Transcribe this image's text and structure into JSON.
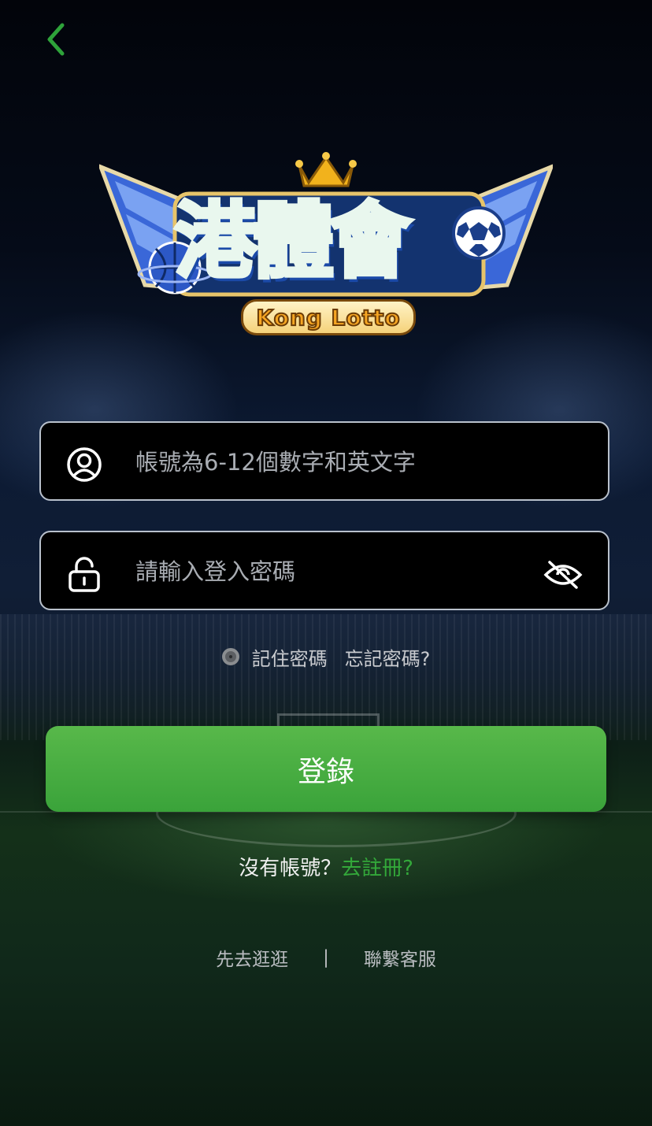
{
  "header": {
    "back_icon": "chevron-left-icon",
    "accent": "#2ea33a"
  },
  "logo": {
    "title": "港體會",
    "subtitle": "Kong Lotto",
    "icons": [
      "crown-icon",
      "wings-icon",
      "basketball-icon",
      "soccer-ball-icon"
    ]
  },
  "form": {
    "account": {
      "icon": "user-icon",
      "placeholder": "帳號為6-12個數字和英文字",
      "value": ""
    },
    "password": {
      "icon": "lock-icon",
      "placeholder": "請輸入登入密碼",
      "value": "",
      "toggle_icon": "eye-off-icon"
    },
    "remember_label": "記住密碼",
    "forgot_label": "忘記密碼?",
    "login_label": "登錄"
  },
  "register": {
    "prompt": "沒有帳號？",
    "link": "去註冊?"
  },
  "footer": {
    "browse": "先去逛逛",
    "separator": "|",
    "support": "聯繫客服"
  },
  "colors": {
    "button_green": "#46ad40",
    "link_green": "#33a83a",
    "field_border": "#b9c1cc"
  }
}
